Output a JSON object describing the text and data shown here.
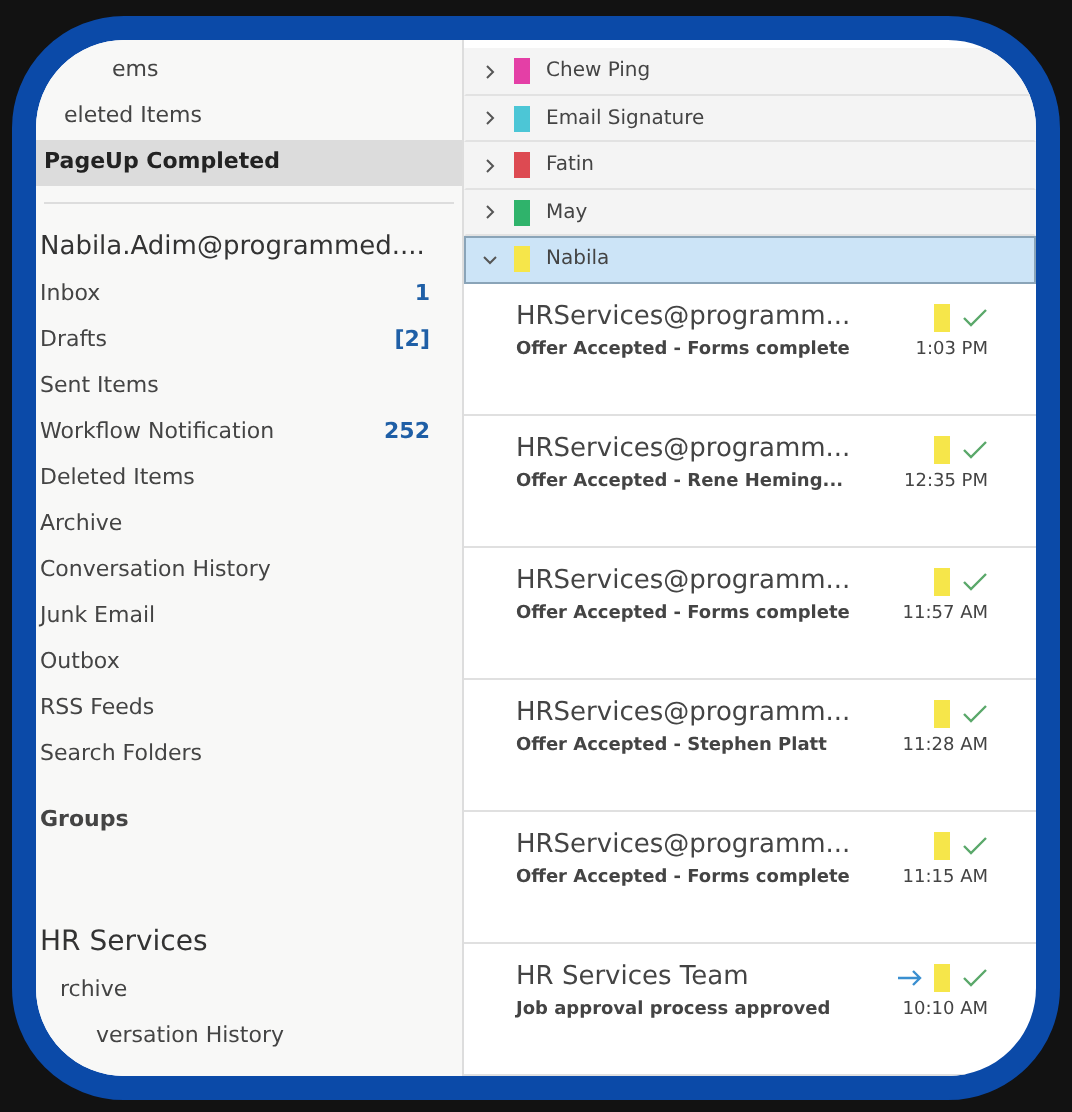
{
  "folders_top": [
    {
      "label": "ems",
      "selected": false
    },
    {
      "label": "eleted Items",
      "selected": false
    },
    {
      "label": "PageUp Completed",
      "selected": true
    }
  ],
  "account": {
    "name": "Nabila.Adim@programmed....",
    "folders": [
      {
        "label": "Inbox",
        "count": "1"
      },
      {
        "label": "Drafts",
        "count": "[2]"
      },
      {
        "label": "Sent Items"
      },
      {
        "label": "Workflow Notification",
        "count": "252"
      },
      {
        "label": "Deleted Items"
      },
      {
        "label": "Archive"
      },
      {
        "label": "Conversation History"
      },
      {
        "label": "Junk Email"
      },
      {
        "label": "Outbox"
      },
      {
        "label": "RSS Feeds"
      },
      {
        "label": "Search Folders"
      }
    ]
  },
  "groups": {
    "label": "Groups"
  },
  "account_2": {
    "name": "HR Services",
    "folders": [
      {
        "label": "rchive"
      },
      {
        "label": "versation History"
      }
    ]
  },
  "categories": [
    {
      "label": "Chew Ping",
      "color": "#e43fa6",
      "expanded": false,
      "selected": false
    },
    {
      "label": "Email Signature",
      "color": "#4cc6d6",
      "expanded": false,
      "selected": false
    },
    {
      "label": "Fatin",
      "color": "#dd4a52",
      "expanded": false,
      "selected": false
    },
    {
      "label": "May",
      "color": "#2fb36b",
      "expanded": false,
      "selected": false
    },
    {
      "label": "Nabila",
      "color": "#f6e64a",
      "expanded": true,
      "selected": true
    }
  ],
  "messages": [
    {
      "sender": "HRServices@programm...",
      "subject": "Offer Accepted - Forms complete",
      "time": "1:03 PM",
      "color": "#f6e64a",
      "forwarded": false,
      "done": true
    },
    {
      "sender": "HRServices@programm...",
      "subject": "Offer Accepted - Rene Heming...",
      "time": "12:35 PM",
      "color": "#f6e64a",
      "forwarded": false,
      "done": true
    },
    {
      "sender": "HRServices@programm...",
      "subject": "Offer Accepted - Forms complete",
      "time": "11:57 AM",
      "color": "#f6e64a",
      "forwarded": false,
      "done": true
    },
    {
      "sender": "HRServices@programm...",
      "subject": "Offer Accepted - Stephen Platt",
      "time": "11:28 AM",
      "color": "#f6e64a",
      "forwarded": false,
      "done": true
    },
    {
      "sender": "HRServices@programm...",
      "subject": "Offer Accepted - Forms complete",
      "time": "11:15 AM",
      "color": "#f6e64a",
      "forwarded": false,
      "done": true
    },
    {
      "sender": "HR Services Team",
      "subject": "Job approval process approved",
      "time": "10:10 AM",
      "color": "#f6e64a",
      "forwarded": true,
      "done": true
    }
  ]
}
